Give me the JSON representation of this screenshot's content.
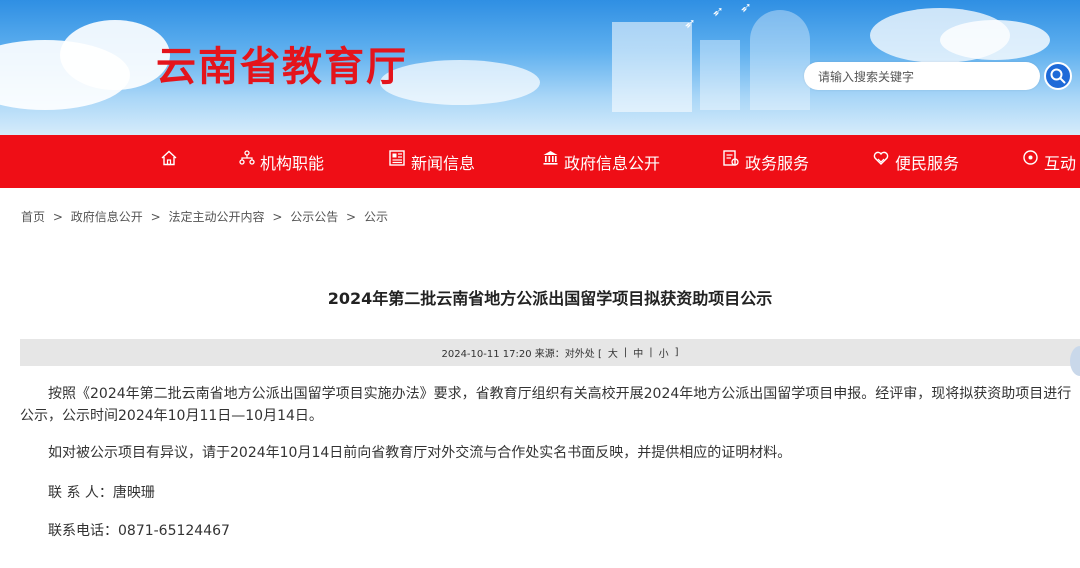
{
  "header": {
    "site_title": "云南省教育厅",
    "search_placeholder": "请输入搜索关键字"
  },
  "nav": {
    "items": [
      {
        "label": "",
        "icon": "home-icon"
      },
      {
        "label": "机构职能",
        "icon": "org-icon"
      },
      {
        "label": "新闻信息",
        "icon": "news-icon"
      },
      {
        "label": "政府信息公开",
        "icon": "government-icon"
      },
      {
        "label": "政务服务",
        "icon": "service-icon"
      },
      {
        "label": "便民服务",
        "icon": "heart-hand-icon"
      },
      {
        "label": "互动",
        "icon": "interact-icon"
      }
    ]
  },
  "breadcrumb": [
    "首页",
    "政府信息公开",
    "法定主动公开内容",
    "公示公告",
    "公示"
  ],
  "breadcrumb_sep": ">",
  "article": {
    "title": "2024年第二批云南省地方公派出国留学项目拟获资助项目公示",
    "meta": "2024-10-11 17:20 来源：对外处 [",
    "font_sizes": [
      "大",
      "中",
      "小"
    ],
    "meta_close": "]",
    "meta_divider": "|",
    "paragraphs": [
      "按照《2024年第二批云南省地方公派出国留学项目实施办法》要求，省教育厅组织有关高校开展2024年地方公派出国留学项目申报。经评审，现将拟获资助项目进行",
      "公示，公示时间2024年10月11日—10月14日。",
      "如对被公示项目有异议，请于2024年10月14日前向省教育厅对外交流与合作处实名书面反映，并提供相应的证明材料。",
      "联 系 人：唐映珊",
      "联系电话：0871-65124467"
    ]
  },
  "colors": {
    "nav_red": "#ef0e16",
    "title_red": "#e4141b",
    "search_blue": "#1e6ad8",
    "meta_gray": "#e6e6e6"
  }
}
